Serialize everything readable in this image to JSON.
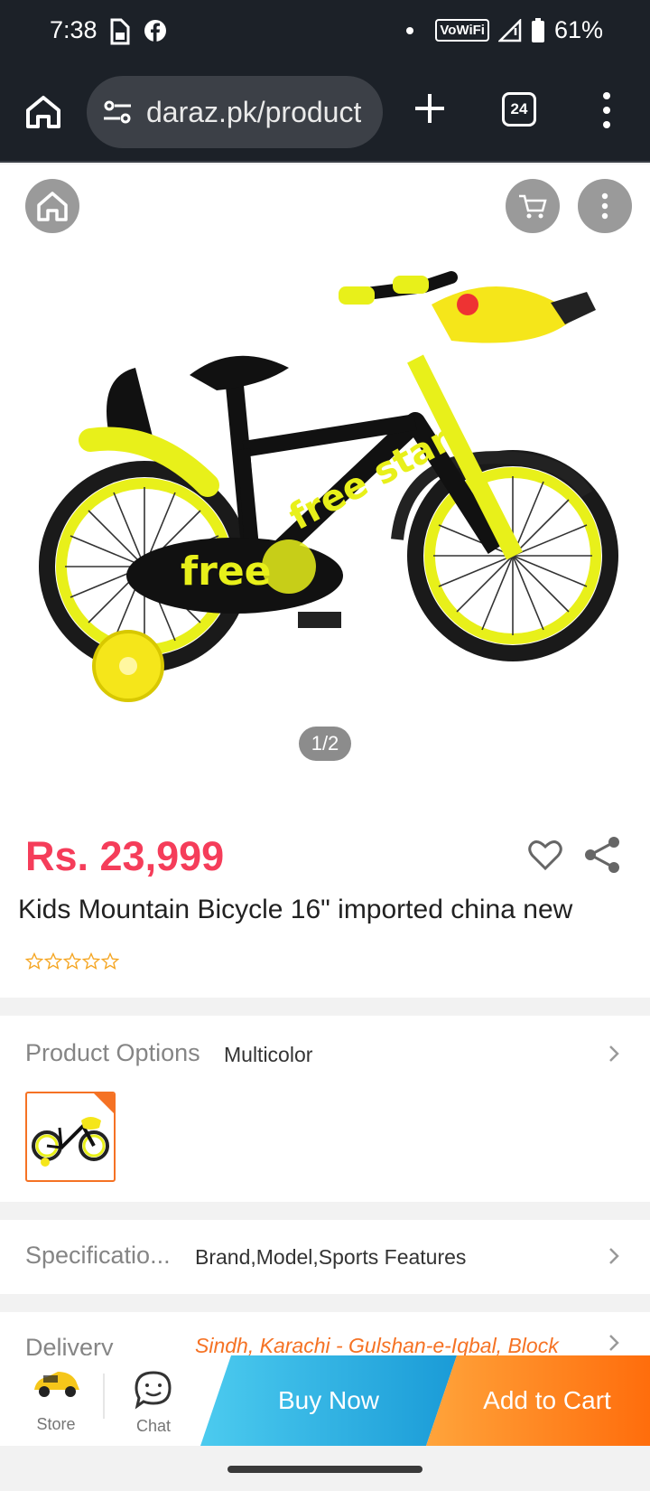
{
  "status_bar": {
    "time": "7:38",
    "vowifi": "VoWiFi",
    "battery": "61%",
    "icons": [
      "sim-icon",
      "facebook-icon",
      "notification-dot-icon",
      "vowifi-icon",
      "signal-icon",
      "battery-icon"
    ]
  },
  "browser": {
    "url": "daraz.pk/product",
    "tab_count": "24",
    "icons": [
      "home-icon",
      "site-settings-icon",
      "new-tab-icon",
      "tabs-icon",
      "menu-icon"
    ]
  },
  "gallery": {
    "counter": "1/2",
    "icons": [
      "home-icon",
      "cart-icon",
      "more-icon"
    ]
  },
  "product": {
    "price": "Rs. 23,999",
    "title": "Kids Mountain Bicycle 16\" imported china new",
    "rating_stars": 0,
    "max_stars": 5
  },
  "options": {
    "label": "Product Options",
    "value": "Multicolor"
  },
  "specifications": {
    "label": "Specificatio...",
    "value": "Brand,Model,Sports Features"
  },
  "delivery": {
    "label": "Delivery",
    "value": "Sindh, Karachi - Gulshan-e-Iqbal, Block"
  },
  "action_bar": {
    "store_label": "Store",
    "chat_label": "Chat",
    "buy_now": "Buy Now",
    "add_to_cart": "Add to Cart"
  },
  "colors": {
    "price": "#f53d5a",
    "accent_orange": "#f57224",
    "buy_now": "#1a9bd7",
    "add_to_cart": "#ff6d0c",
    "top_bar": "#1c2128"
  }
}
